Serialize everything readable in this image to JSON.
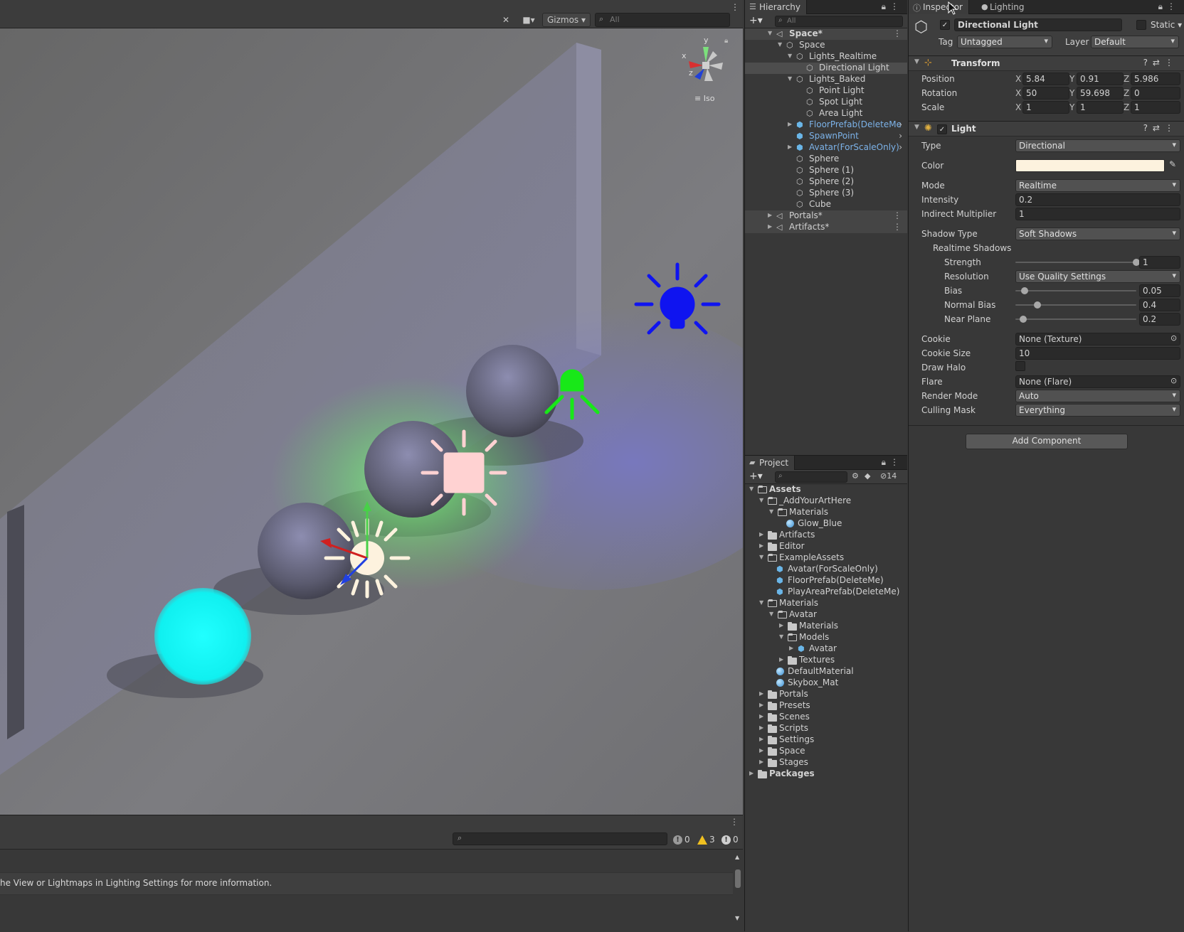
{
  "scene_toolbar": {
    "gizmos_label": "Gizmos",
    "search_placeholder": "All"
  },
  "scene_gizmo": {
    "axis_y": "y",
    "axis_x": "x",
    "axis_z": "z",
    "projection_label": "Iso"
  },
  "console": {
    "counts": {
      "info": "0",
      "warnings": "3",
      "errors": "0"
    },
    "message": "he View or Lightmaps in Lighting Settings for more information."
  },
  "hierarchy": {
    "tab_label": "Hierarchy",
    "search_placeholder": "All",
    "items": [
      {
        "label": "Space*"
      },
      {
        "label": "Space"
      },
      {
        "label": "Lights_Realtime"
      },
      {
        "label": "Directional Light"
      },
      {
        "label": "Lights_Baked"
      },
      {
        "label": "Point Light"
      },
      {
        "label": "Spot Light"
      },
      {
        "label": "Area Light"
      },
      {
        "label": "FloorPrefab(DeleteMe"
      },
      {
        "label": "SpawnPoint"
      },
      {
        "label": "Avatar(ForScaleOnly)"
      },
      {
        "label": "Sphere"
      },
      {
        "label": "Sphere (1)"
      },
      {
        "label": "Sphere (2)"
      },
      {
        "label": "Sphere (3)"
      },
      {
        "label": "Cube"
      },
      {
        "label": "Portals*"
      },
      {
        "label": "Artifacts*"
      }
    ]
  },
  "project": {
    "tab_label": "Project",
    "hidden_count": "14",
    "items": [
      {
        "label": "Assets"
      },
      {
        "label": "_AddYourArtHere"
      },
      {
        "label": "Materials"
      },
      {
        "label": "Glow_Blue"
      },
      {
        "label": "Artifacts"
      },
      {
        "label": "Editor"
      },
      {
        "label": "ExampleAssets"
      },
      {
        "label": "Avatar(ForScaleOnly)"
      },
      {
        "label": "FloorPrefab(DeleteMe)"
      },
      {
        "label": "PlayAreaPrefab(DeleteMe)"
      },
      {
        "label": "Materials"
      },
      {
        "label": "Avatar"
      },
      {
        "label": "Materials"
      },
      {
        "label": "Models"
      },
      {
        "label": "Avatar"
      },
      {
        "label": "Textures"
      },
      {
        "label": "DefaultMaterial"
      },
      {
        "label": "Skybox_Mat"
      },
      {
        "label": "Portals"
      },
      {
        "label": "Presets"
      },
      {
        "label": "Scenes"
      },
      {
        "label": "Scripts"
      },
      {
        "label": "Settings"
      },
      {
        "label": "Space"
      },
      {
        "label": "Stages"
      },
      {
        "label": "Packages"
      }
    ]
  },
  "inspector": {
    "tabs": {
      "inspector": "Inspector",
      "lighting": "Lighting"
    },
    "object_name": "Directional Light",
    "static_label": "Static",
    "tag_label": "Tag",
    "tag_value": "Untagged",
    "layer_label": "Layer",
    "layer_value": "Default",
    "transform": {
      "title": "Transform",
      "position_label": "Position",
      "rotation_label": "Rotation",
      "scale_label": "Scale",
      "position": {
        "x": "5.84",
        "y": "0.91",
        "z": "5.986"
      },
      "rotation": {
        "x": "50",
        "y": "59.698",
        "z": "0"
      },
      "scale": {
        "x": "1",
        "y": "1",
        "z": "1"
      }
    },
    "light": {
      "title": "Light",
      "type_label": "Type",
      "type_value": "Directional",
      "color_label": "Color",
      "color_hex": "#fdf2de",
      "mode_label": "Mode",
      "mode_value": "Realtime",
      "intensity_label": "Intensity",
      "intensity_value": "0.2",
      "indirect_label": "Indirect Multiplier",
      "indirect_value": "1",
      "shadow_type_label": "Shadow Type",
      "shadow_type_value": "Soft Shadows",
      "realtime_shadows_label": "Realtime Shadows",
      "strength_label": "Strength",
      "strength_value": "1",
      "resolution_label": "Resolution",
      "resolution_value": "Use Quality Settings",
      "bias_label": "Bias",
      "bias_value": "0.05",
      "normal_bias_label": "Normal Bias",
      "normal_bias_value": "0.4",
      "near_plane_label": "Near Plane",
      "near_plane_value": "0.2",
      "cookie_label": "Cookie",
      "cookie_value": "None (Texture)",
      "cookie_size_label": "Cookie Size",
      "cookie_size_value": "10",
      "draw_halo_label": "Draw Halo",
      "flare_label": "Flare",
      "flare_value": "None (Flare)",
      "render_mode_label": "Render Mode",
      "render_mode_value": "Auto",
      "culling_mask_label": "Culling Mask",
      "culling_mask_value": "Everything"
    },
    "add_component_label": "Add Component"
  }
}
